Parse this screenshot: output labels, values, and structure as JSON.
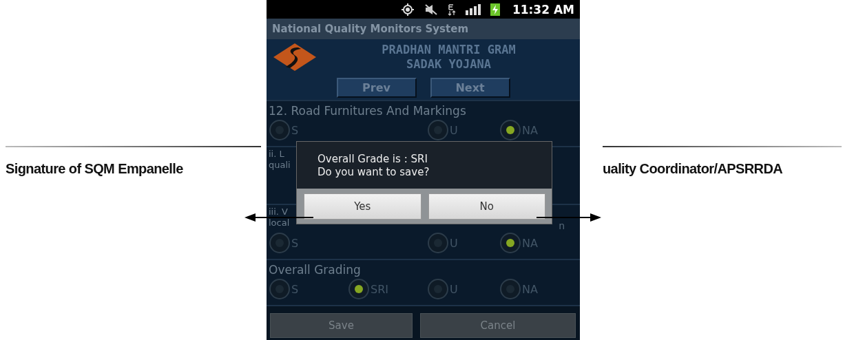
{
  "document": {
    "left_caption": "Signature of SQM Empanelle",
    "right_caption": "uality Coordinator/APSRRDA"
  },
  "status_bar": {
    "time": "11:32 AM"
  },
  "app_title": "National Quality Monitors System",
  "header": {
    "lines": [
      "PRADHAN MANTRI GRAM",
      "SADAK YOJANA"
    ]
  },
  "nav_buttons": [
    "Prev",
    "Next"
  ],
  "sections": [
    {
      "kind": "radio",
      "title_lines": [
        "12. Road Furnitures And Markings"
      ],
      "options": [
        {
          "label": "S",
          "selected": false
        },
        {
          "label": "U",
          "selected": false
        },
        {
          "label": "NA",
          "selected": true
        }
      ]
    },
    {
      "kind": "covered",
      "title_lines": [
        "ii. L",
        "quali"
      ]
    },
    {
      "kind": "radio",
      "title_lines": [
        "iii. V",
        "local"
      ],
      "side_text": "n",
      "options": [
        {
          "label": "S",
          "selected": false
        },
        {
          "label": "U",
          "selected": false
        },
        {
          "label": "NA",
          "selected": true
        }
      ]
    },
    {
      "kind": "radio",
      "title_lines": [
        "Overall Grading"
      ],
      "options": [
        {
          "label": "S",
          "selected": false
        },
        {
          "label": "SRI",
          "selected": true
        },
        {
          "label": "U",
          "selected": false
        },
        {
          "label": "NA",
          "selected": false
        }
      ]
    }
  ],
  "bottom_buttons": [
    "Save",
    "Cancel"
  ],
  "dialog": {
    "message_lines": [
      "Overall Grade is : SRI",
      "Do you want to save?"
    ],
    "buttons": [
      "Yes",
      "No"
    ]
  }
}
